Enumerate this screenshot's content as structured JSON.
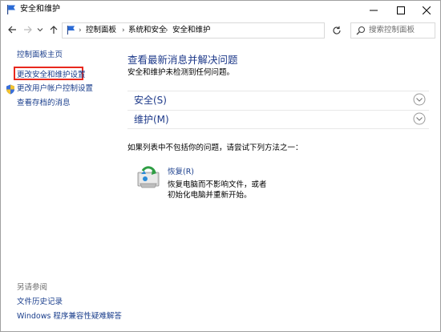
{
  "window": {
    "title": "安全和维护",
    "buttons": {
      "minimize": "minimize",
      "maximize": "maximize",
      "close": "close"
    }
  },
  "navbar": {
    "breadcrumbs": [
      "控制面板",
      "系统和安全",
      "安全和维护"
    ],
    "search_placeholder": "搜索控制面板"
  },
  "leftpane": {
    "home": "控制面板主页",
    "change_settings": "更改安全和维护设置",
    "uac_settings": "更改用户帐户控制设置",
    "archived_messages": "查看存档的消息",
    "see_also": "另请参阅",
    "file_history": "文件历史记录",
    "compat": "Windows 程序兼容性疑难解答"
  },
  "main": {
    "heading": "查看最新消息并解决问题",
    "status": "安全和维护未检测到任何问题。",
    "sections": [
      {
        "label": "安全(S)",
        "expanded": false
      },
      {
        "label": "维护(M)",
        "expanded": false
      }
    ],
    "not_listed": "如果列表中不包括你的问题，请尝试下列方法之一：",
    "recovery": {
      "link": "恢复(R)",
      "desc_line1": "恢复电脑而不影响文件，或者",
      "desc_line2": "初始化电脑并重新开始。"
    }
  },
  "colors": {
    "link": "#1a3e8c",
    "heading": "#1e3a8a",
    "highlight_border": "#e8281e",
    "muted": "#6d6d6d"
  }
}
